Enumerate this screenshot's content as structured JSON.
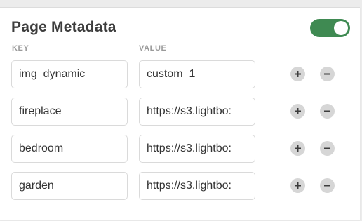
{
  "panel": {
    "title": "Page Metadata",
    "toggle_on": true,
    "toggle_color": "#3f8a52"
  },
  "columns": {
    "key": "KEY",
    "value": "VALUE"
  },
  "rows": [
    {
      "key": "img_dynamic",
      "value": "custom_1",
      "add_icon": "plus-circle-icon",
      "remove_icon": "minus-circle-icon"
    },
    {
      "key": "fireplace",
      "value": "https://s3.lightbo:",
      "add_icon": "plus-circle-icon",
      "remove_icon": "minus-circle-icon"
    },
    {
      "key": "bedroom",
      "value": "https://s3.lightbo:",
      "add_icon": "plus-circle-icon",
      "remove_icon": "minus-circle-icon"
    },
    {
      "key": "garden",
      "value": "https://s3.lightbo:",
      "add_icon": "plus-circle-icon",
      "remove_icon": "minus-circle-icon"
    }
  ]
}
